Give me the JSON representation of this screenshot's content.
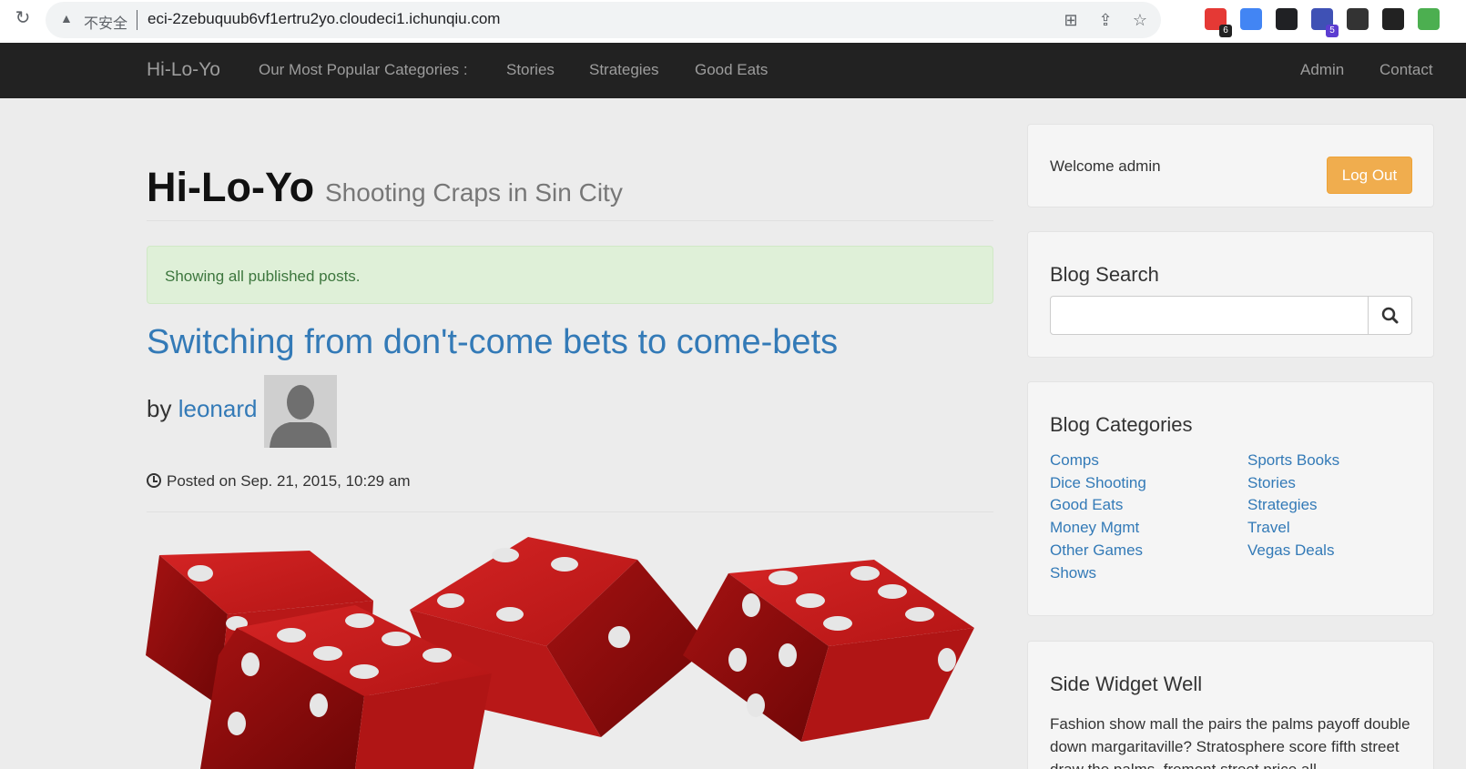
{
  "browser": {
    "insecure_label": "不安全",
    "url": "eci-2zebuquub6vf1ertru2yo.cloudeci1.ichunqiu.com",
    "extensions": [
      {
        "name": "ext-1",
        "badge": "6",
        "color": "#e53935",
        "badge_color": "#222222"
      },
      {
        "name": "ext-translate",
        "badge": "",
        "color": "#4285f4"
      },
      {
        "name": "ext-monitor",
        "badge": "",
        "color": "#202124"
      },
      {
        "name": "ext-4",
        "badge": "5",
        "color": "#3f51b5",
        "badge_color": "#5c3dd1"
      },
      {
        "name": "ext-5",
        "badge": "",
        "color": "#333333"
      },
      {
        "name": "ext-6",
        "badge": "",
        "color": "#222222"
      },
      {
        "name": "ext-7",
        "badge": "",
        "color": "#4caf50"
      }
    ]
  },
  "navbar": {
    "brand": "Hi-Lo-Yo",
    "popular": "Our Most Popular Categories :",
    "items": [
      "Stories",
      "Strategies",
      "Good Eats"
    ],
    "right": [
      "Admin",
      "Contact"
    ]
  },
  "header": {
    "title": "Hi-Lo-Yo",
    "subtitle": "Shooting Craps in Sin City"
  },
  "alert": "Showing all published posts.",
  "post": {
    "title": "Switching from don't-come bets to come-bets",
    "by": "by",
    "author": "leonard",
    "posted": "Posted on Sep. 21, 2015, 10:29 am"
  },
  "sidebar": {
    "welcome": "Welcome admin",
    "logout": "Log Out",
    "search_title": "Blog Search",
    "categories_title": "Blog Categories",
    "categories_left": [
      "Comps",
      "Dice Shooting",
      "Good Eats",
      "Money Mgmt",
      "Other Games",
      "Shows"
    ],
    "categories_right": [
      "Sports Books",
      "Stories",
      "Strategies",
      "Travel",
      "Vegas Deals"
    ],
    "widget_title": "Side Widget Well",
    "widget_text": "Fashion show mall the pairs the palms payoff double down margaritaville? Stratosphere score fifth street draw the palms, fremont street price all"
  },
  "colors": {
    "link": "#337ab7",
    "navbar": "#222222",
    "logout": "#f0ad4e",
    "alert_bg": "#dff0d8",
    "dice": "#c41a1a"
  }
}
